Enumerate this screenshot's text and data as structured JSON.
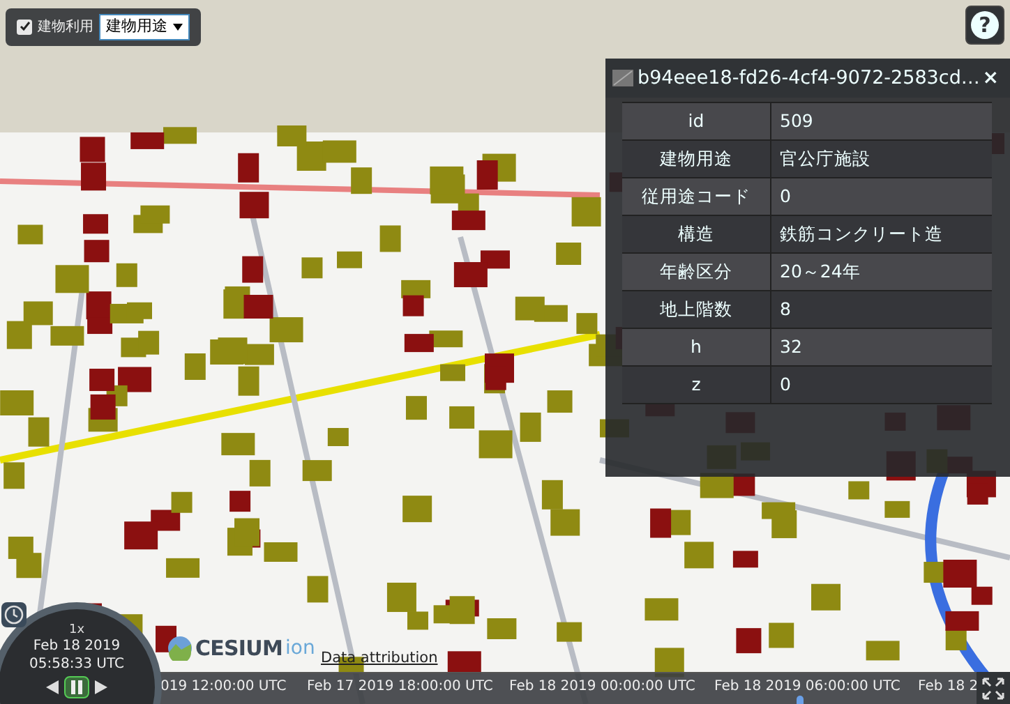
{
  "toolbar": {
    "checkbox": {
      "label": "建物利用",
      "checked": true
    },
    "select": {
      "value": "建物用途"
    }
  },
  "help_button": {
    "label": "?"
  },
  "infobox": {
    "title": "b94eee18-fd26-4cf4-9072-2583cd…",
    "close": "×",
    "rows": [
      {
        "key": "id",
        "value": "509"
      },
      {
        "key": "建物用途",
        "value": "官公庁施設"
      },
      {
        "key": "従用途コード",
        "value": "0"
      },
      {
        "key": "構造",
        "value": "鉄筋コンクリート造"
      },
      {
        "key": "年齢区分",
        "value": "20～24年"
      },
      {
        "key": "地上階数",
        "value": "8"
      },
      {
        "key": "h",
        "value": "32"
      },
      {
        "key": "z",
        "value": "0"
      }
    ]
  },
  "animation": {
    "speed": "1x",
    "date": "Feb 18 2019",
    "time": "05:58:33 UTC",
    "playing": true
  },
  "credits": {
    "logo": "CESIUM",
    "logo_suffix": "ion",
    "link": "Data attribution"
  },
  "timeline": {
    "labels": [
      "019 12:00:00 UTC",
      "Feb 17 2019 18:00:00 UTC",
      "Feb 18 2019 00:00:00 UTC",
      "Feb 18 2019 06:00:00 UTC",
      "Feb 18 2"
    ],
    "level": 0.78
  }
}
